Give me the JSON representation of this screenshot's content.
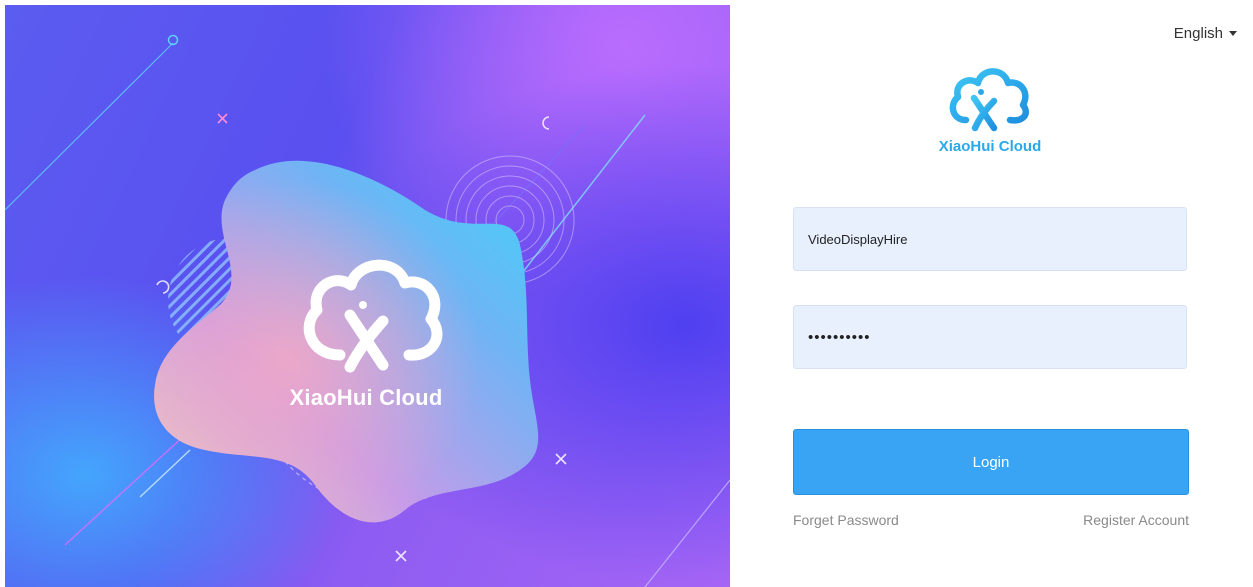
{
  "hero": {
    "brand_name": "XiaoHui Cloud"
  },
  "header": {
    "language_label": "English",
    "language_icon": "caret-down-icon"
  },
  "logo": {
    "brand_name": "XiaoHui Cloud",
    "icon": "cloud-logo-icon",
    "color": "#2aa9e9"
  },
  "form": {
    "username_value": "VideoDisplayHire",
    "password_value": "••••••••••",
    "login_label": "Login",
    "forget_password_label": "Forget Password",
    "register_label": "Register Account"
  },
  "colors": {
    "primary": "#39a4f4",
    "input_bg": "#e8f0fe",
    "link": "#8a8a8a"
  }
}
